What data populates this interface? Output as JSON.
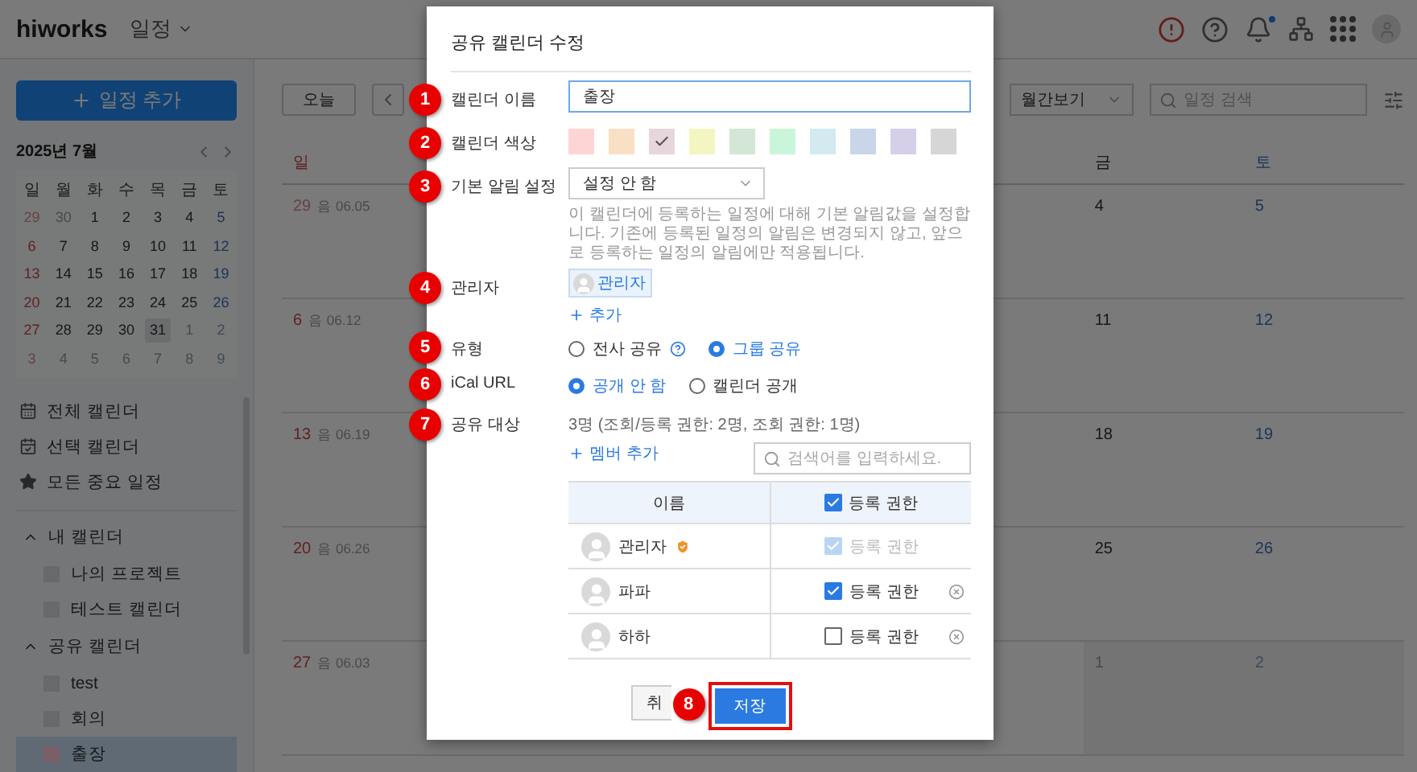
{
  "header": {
    "logo": "hiworks",
    "app_menu": "일정",
    "notification_unread": true
  },
  "sidebar": {
    "add_button": "일정 추가",
    "mini_calendar": {
      "title": "2025년 7월",
      "weekdays": [
        "일",
        "월",
        "화",
        "수",
        "목",
        "금",
        "토"
      ],
      "weeks": [
        [
          {
            "day": "29",
            "muted": true,
            "today": false
          },
          {
            "day": "30",
            "muted": true,
            "today": false
          },
          {
            "day": "1",
            "muted": false,
            "today": false
          },
          {
            "day": "2",
            "muted": false,
            "today": false
          },
          {
            "day": "3",
            "muted": false,
            "today": false
          },
          {
            "day": "4",
            "muted": false,
            "today": false
          },
          {
            "day": "5",
            "muted": false,
            "today": false
          }
        ],
        [
          {
            "day": "6",
            "muted": false,
            "today": false
          },
          {
            "day": "7",
            "muted": false,
            "today": false
          },
          {
            "day": "8",
            "muted": false,
            "today": false
          },
          {
            "day": "9",
            "muted": false,
            "today": false
          },
          {
            "day": "10",
            "muted": false,
            "today": false
          },
          {
            "day": "11",
            "muted": false,
            "today": false
          },
          {
            "day": "12",
            "muted": false,
            "today": false
          }
        ],
        [
          {
            "day": "13",
            "muted": false,
            "today": false
          },
          {
            "day": "14",
            "muted": false,
            "today": false
          },
          {
            "day": "15",
            "muted": false,
            "today": false
          },
          {
            "day": "16",
            "muted": false,
            "today": false
          },
          {
            "day": "17",
            "muted": false,
            "today": false
          },
          {
            "day": "18",
            "muted": false,
            "today": false
          },
          {
            "day": "19",
            "muted": false,
            "today": false
          }
        ],
        [
          {
            "day": "20",
            "muted": false,
            "today": false
          },
          {
            "day": "21",
            "muted": false,
            "today": false
          },
          {
            "day": "22",
            "muted": false,
            "today": false
          },
          {
            "day": "23",
            "muted": false,
            "today": false
          },
          {
            "day": "24",
            "muted": false,
            "today": false
          },
          {
            "day": "25",
            "muted": false,
            "today": false
          },
          {
            "day": "26",
            "muted": false,
            "today": false
          }
        ],
        [
          {
            "day": "27",
            "muted": false,
            "today": false
          },
          {
            "day": "28",
            "muted": false,
            "today": false
          },
          {
            "day": "29",
            "muted": false,
            "today": false
          },
          {
            "day": "30",
            "muted": false,
            "today": false
          },
          {
            "day": "31",
            "muted": false,
            "today": true
          },
          {
            "day": "1",
            "muted": true,
            "today": false
          },
          {
            "day": "2",
            "muted": true,
            "today": false
          }
        ],
        [
          {
            "day": "3",
            "muted": true,
            "today": false
          },
          {
            "day": "4",
            "muted": true,
            "today": false
          },
          {
            "day": "5",
            "muted": true,
            "today": false
          },
          {
            "day": "6",
            "muted": true,
            "today": false
          },
          {
            "day": "7",
            "muted": true,
            "today": false
          },
          {
            "day": "8",
            "muted": true,
            "today": false
          },
          {
            "day": "9",
            "muted": true,
            "today": false
          }
        ]
      ]
    },
    "links": [
      {
        "label": "전체 캘린더",
        "kind": "all"
      },
      {
        "label": "선택 캘린더",
        "kind": "selected"
      },
      {
        "label": "모든 중요 일정",
        "kind": "important"
      }
    ],
    "sections": [
      {
        "title": "내 캘린더",
        "expanded": true,
        "items": [
          {
            "label": "나의 프로젝트",
            "color": "#67696c",
            "selected": false
          },
          {
            "label": "테스트 캘린더",
            "color": "#67696c",
            "selected": false
          }
        ]
      },
      {
        "title": "공유 캘린더",
        "expanded": true,
        "items": [
          {
            "label": "test",
            "color": "#67696c",
            "selected": false
          },
          {
            "label": "회의",
            "color": "#67696c",
            "selected": false
          },
          {
            "label": "출장",
            "color": "#7a5f69",
            "selected": true
          }
        ]
      }
    ]
  },
  "toolbar": {
    "today_button": "오늘",
    "view_select": "월간보기",
    "search_placeholder": "일정 검색"
  },
  "month": {
    "weekdays": [
      {
        "label": "일",
        "kind": "sun"
      },
      {
        "label": "금",
        "kind": "weekday"
      },
      {
        "label": "토",
        "kind": "sat"
      }
    ],
    "weeks": [
      {
        "sunday": {
          "day": "29",
          "lunar": "음 06.05",
          "muted": true
        },
        "friday": {
          "day": "4",
          "muted": false
        },
        "saturday": {
          "day": "5",
          "muted": false
        }
      },
      {
        "sunday": {
          "day": "6",
          "lunar": "음 06.12",
          "muted": false
        },
        "friday": {
          "day": "11",
          "muted": false
        },
        "saturday": {
          "day": "12",
          "muted": false
        }
      },
      {
        "sunday": {
          "day": "13",
          "lunar": "음 06.19",
          "muted": false
        },
        "friday": {
          "day": "18",
          "muted": false
        },
        "saturday": {
          "day": "19",
          "muted": false
        }
      },
      {
        "sunday": {
          "day": "20",
          "lunar": "음 06.26",
          "muted": false
        },
        "friday": {
          "day": "25",
          "muted": false
        },
        "saturday": {
          "day": "26",
          "muted": false
        }
      },
      {
        "sunday": {
          "day": "27",
          "lunar": "음 06.03",
          "muted": false
        },
        "friday": {
          "day": "1",
          "muted": true
        },
        "saturday": {
          "day": "2",
          "muted": true
        }
      }
    ]
  },
  "modal": {
    "title": "공유 캘린더 수정",
    "name": {
      "label": "캘린더 이름",
      "value": "출장"
    },
    "color": {
      "label": "캘린더 색상",
      "swatches": [
        {
          "color": "#fdd5d5",
          "selected": false
        },
        {
          "color": "#f9dfc3",
          "selected": false
        },
        {
          "color": "#e8d6dd",
          "selected": true
        },
        {
          "color": "#f4f6c1",
          "selected": false
        },
        {
          "color": "#d4e6d6",
          "selected": false
        },
        {
          "color": "#c9f5da",
          "selected": false
        },
        {
          "color": "#d2eaf0",
          "selected": false
        },
        {
          "color": "#c9d5e8",
          "selected": false
        },
        {
          "color": "#d6cfe9",
          "selected": false
        },
        {
          "color": "#d6d6d6",
          "selected": false
        }
      ]
    },
    "alarm": {
      "label": "기본 알림 설정",
      "value": "설정 안 함",
      "help": "이 캘린더에 등록하는 일정에 대해 기본 알림값을 설정합니다. 기존에 등록된 일정의 알림은 변경되지 않고, 앞으로 등록하는 일정의 알림에만 적용됩니다."
    },
    "admin": {
      "label": "관리자",
      "chips": [
        "관리자"
      ],
      "add": "추가"
    },
    "type": {
      "label": "유형",
      "options": [
        {
          "label": "전사 공유",
          "selected": false,
          "help": true
        },
        {
          "label": "그룹 공유",
          "selected": true,
          "help": false
        }
      ]
    },
    "ical": {
      "label": "iCal URL",
      "options": [
        {
          "label": "공개 안 함",
          "selected": true,
          "help": false
        },
        {
          "label": "캘린더 공개",
          "selected": false,
          "help": false
        }
      ]
    },
    "share": {
      "label": "공유 대상",
      "summary": "3명 (조회/등록 권한: 2명, 조회 권한: 1명)",
      "add_member": "멤버 추가",
      "search_placeholder": "검색어를 입력하세요.",
      "columns": {
        "name": "이름",
        "permission": "등록 권한",
        "permission_checked": true
      },
      "members": [
        {
          "name": "관리자",
          "owner": true,
          "permission": "등록 권한",
          "checked": true,
          "disabled": true,
          "removable": false
        },
        {
          "name": "파파",
          "owner": false,
          "permission": "등록 권한",
          "checked": true,
          "disabled": false,
          "removable": true
        },
        {
          "name": "하하",
          "owner": false,
          "permission": "등록 권한",
          "checked": false,
          "disabled": false,
          "removable": true
        }
      ]
    },
    "buttons": {
      "cancel": "취",
      "save": "저장",
      "save_highlighted": true
    }
  },
  "annotations": [
    {
      "number": "1"
    },
    {
      "number": "2"
    },
    {
      "number": "3"
    },
    {
      "number": "4"
    },
    {
      "number": "5"
    },
    {
      "number": "6"
    },
    {
      "number": "7"
    },
    {
      "number": "8"
    }
  ]
}
